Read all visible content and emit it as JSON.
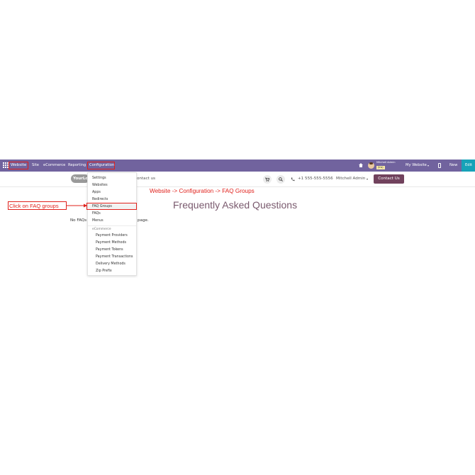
{
  "topbar": {
    "app_name": "Website",
    "menu": [
      "Site",
      "eCommerce",
      "Reporting",
      "Configuration"
    ],
    "user_name": "Mitchell Admin",
    "user_db": "(Ins)",
    "my_website": "My Website",
    "new_label": "New",
    "edit_label": "Edit"
  },
  "header": {
    "logo_text": "YourLo",
    "contact_nav": "ontact us",
    "phone": "+1 555-555-5556",
    "user": "Mitchell Admin",
    "contact_button": "Contact Us"
  },
  "dropdown": {
    "items": [
      "Settings",
      "Websites",
      "Apps",
      "Redirects",
      "FAQ Groups",
      "FAQs",
      "Menus"
    ],
    "section_title": "eCommerce",
    "sub_items": [
      "Payment Providers",
      "Payment Methods",
      "Payment Tokens",
      "Payment Transactions",
      "Delivery Methods",
      "Zip Prefix"
    ]
  },
  "annotations": {
    "path": "Website -> Configuration -> FAQ Groups",
    "callout": "Click on FAQ groups"
  },
  "main": {
    "title": "Frequently Asked Questions",
    "no_faq_left": "No FAQs",
    "no_faq_right": "page."
  },
  "colors": {
    "topbar": "#71639e",
    "annotation": "#e0201b",
    "contact_button": "#71425d",
    "edit_button": "#17a2b8"
  }
}
